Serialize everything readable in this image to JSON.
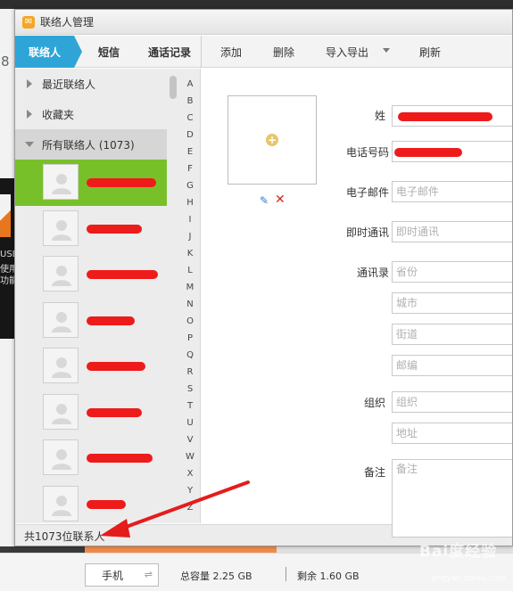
{
  "window": {
    "title": "联络人管理"
  },
  "background": {
    "left_number": "8",
    "left_texts": [
      "USB",
      "使用",
      "功能"
    ]
  },
  "tabs": [
    {
      "label": "联络人",
      "active": true
    },
    {
      "label": "短信",
      "active": false
    },
    {
      "label": "通话记录",
      "active": false
    }
  ],
  "toolbar": {
    "add_label": "添加",
    "delete_label": "删除",
    "import_export_label": "导入导出",
    "refresh_label": "刷新"
  },
  "groups": [
    {
      "label": "最近联络人",
      "expanded": false
    },
    {
      "label": "收藏夹",
      "expanded": false
    },
    {
      "label": "所有联络人 (1073)",
      "expanded": true
    }
  ],
  "contacts": [
    {
      "selected": true
    },
    {
      "selected": false
    },
    {
      "selected": false
    },
    {
      "selected": false
    },
    {
      "selected": false
    },
    {
      "selected": false
    },
    {
      "selected": false
    },
    {
      "selected": false
    }
  ],
  "alphabet": [
    "A",
    "B",
    "C",
    "D",
    "E",
    "F",
    "G",
    "H",
    "I",
    "J",
    "K",
    "L",
    "M",
    "N",
    "O",
    "P",
    "Q",
    "R",
    "S",
    "T",
    "U",
    "V",
    "W",
    "X",
    "Y",
    "Z"
  ],
  "status": {
    "count_text": "共1073位联系人"
  },
  "form": {
    "surname_label": "姓",
    "phone_label": "电话号码",
    "email_label": "电子邮件",
    "email_placeholder": "电子邮件",
    "im_label": "即时通讯",
    "im_placeholder": "即时通讯",
    "address_label": "通讯录",
    "province_placeholder": "省份",
    "city_placeholder": "城市",
    "street_placeholder": "街道",
    "zip_placeholder": "邮编",
    "org_label": "组织",
    "org_placeholder": "组织",
    "org_address_placeholder": "地址",
    "note_label": "备注",
    "note_placeholder": "备注"
  },
  "bottom": {
    "device": "手机",
    "total_capacity": "总容量 2.25 GB",
    "remaining": "剩余 1.60 GB"
  },
  "colors": {
    "tab_active": "#2fa5d7",
    "selected_contact": "#78c02a",
    "redaction": "#ee1b1b",
    "annotation_arrow": "#e51c1c"
  },
  "watermark": {
    "text": "Bai度经验",
    "sub": "jingyan.baidu.com"
  }
}
